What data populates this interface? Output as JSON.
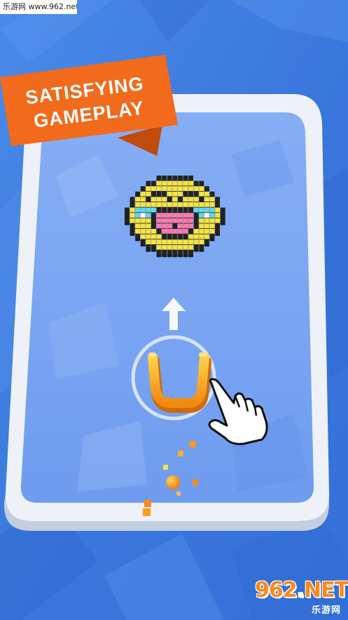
{
  "watermark": {
    "text": "乐游网 www.962.net"
  },
  "banner": {
    "line1": "SATISFYING",
    "line2": "GAMEPLAY"
  },
  "logo": {
    "main": "962",
    "suffix": "NET",
    "sub": "乐游网"
  },
  "colors": {
    "water": "#3f7fe0",
    "tray_border": "#e9eef5",
    "tray_floor": "#7aa6f2",
    "banner": "#f26a1b",
    "banner_dark": "#c64b0d",
    "pixel_yellow": "#f9e43a",
    "pixel_dark": "#232323",
    "pixel_pink": "#ff7aa8",
    "pixel_cyan": "#5fd9f0",
    "paddle": "#f7a91b",
    "ball": "#ff9a00"
  }
}
